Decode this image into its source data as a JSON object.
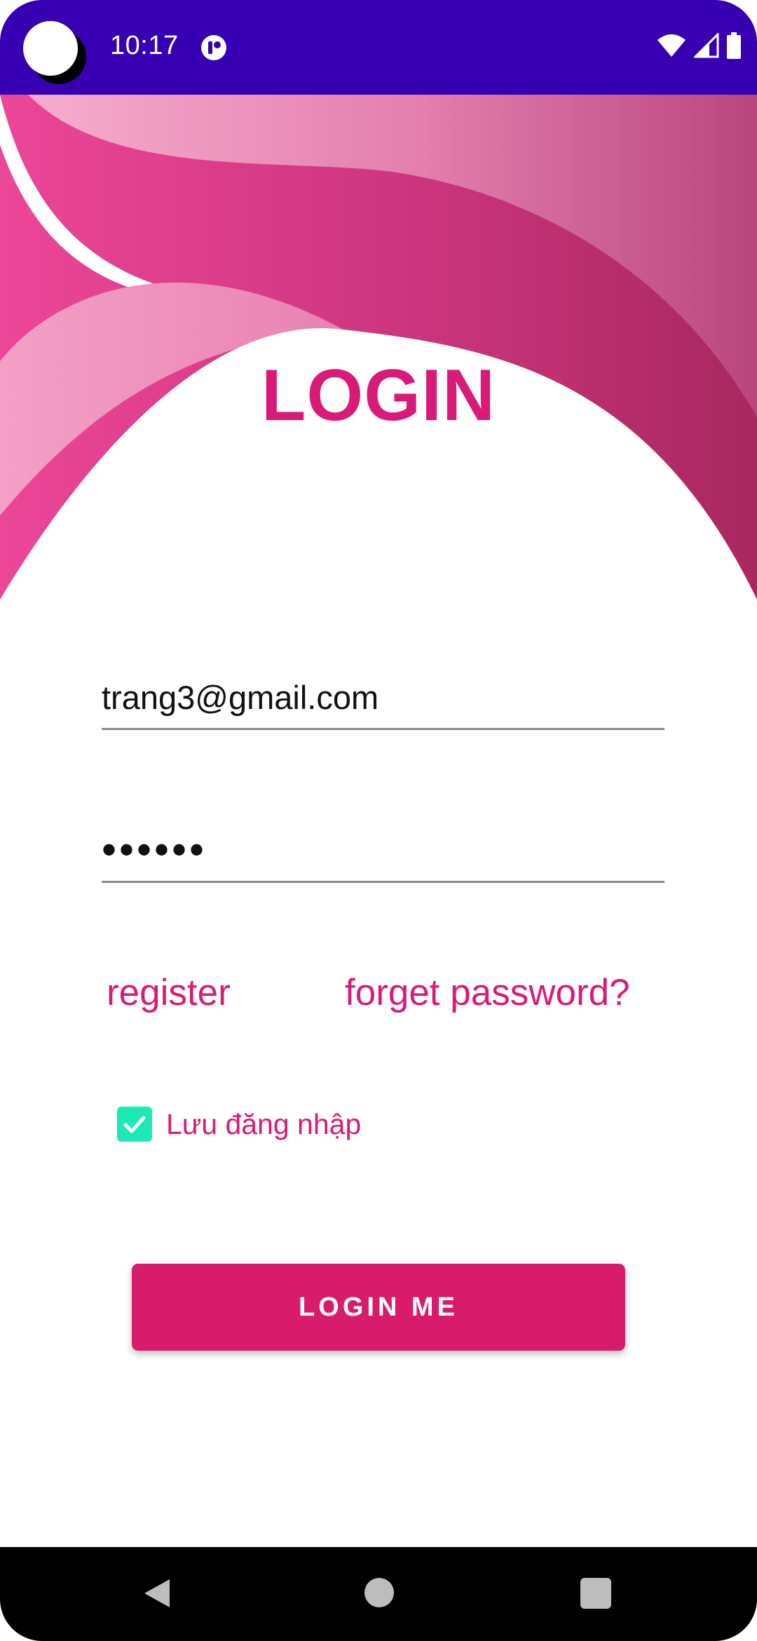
{
  "status_bar": {
    "time": "10:17"
  },
  "title": "LOGIN",
  "form": {
    "email_value": "trang3@gmail.com",
    "password_value": "••••••"
  },
  "links": {
    "register": "register",
    "forget_password": "forget password?"
  },
  "remember": {
    "label": "Lưu đăng nhập",
    "checked": true
  },
  "login_button": "LOGIN ME",
  "icons": {
    "status": [
      "camera-icon",
      "app-notification-icon",
      "wifi-icon",
      "signal-icon",
      "battery-icon"
    ],
    "nav": [
      "back-icon",
      "home-icon",
      "recent-apps-icon"
    ],
    "checkbox": "check-icon"
  },
  "colors": {
    "status_bar": "#3700B3",
    "accent": "#D81B78",
    "button": "#D81B6B",
    "checkbox": "#1DE9B6"
  }
}
